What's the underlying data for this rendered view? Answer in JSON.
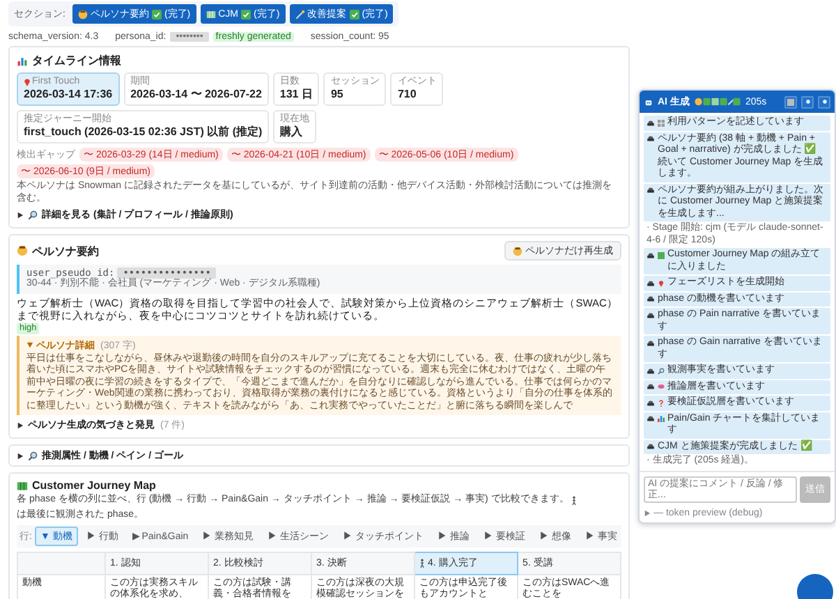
{
  "section_nav": {
    "label": "セクション:",
    "buttons": [
      {
        "label": "ペルソナ要約",
        "status": "(完了)",
        "done": true
      },
      {
        "label": "CJM",
        "status": "(完了)",
        "done": true
      },
      {
        "label": "改善提案",
        "status": "(完了)",
        "done": true
      }
    ]
  },
  "meta": {
    "schema_version": "schema_version: 4.3",
    "persona_id_label": "persona_id:",
    "persona_id": "••••••••",
    "freshness": "freshly generated",
    "session_count": "session_count: 95"
  },
  "timeline": {
    "title": "タイムライン情報",
    "stats": [
      {
        "label": "First Touch",
        "value": "2026-03-14 17:36",
        "selected": true
      },
      {
        "label": "期間",
        "value": "2026-03-14 〜 2026-07-22",
        "selected": false
      },
      {
        "label": "日数",
        "value": "131 日",
        "selected": false
      },
      {
        "label": "セッション",
        "value": "95",
        "selected": false
      },
      {
        "label": "イベント",
        "value": "710",
        "selected": false
      },
      {
        "label": "推定ジャーニー開始",
        "value": "first_touch (2026-03-15 02:36 JST) 以前 (推定)",
        "selected": false
      },
      {
        "label": "現在地",
        "value": "購入",
        "selected": false
      }
    ],
    "gaps_label": "検出ギャップ",
    "gaps": [
      "〜 2026-03-29 (14日 / medium)",
      "〜 2026-04-21 (10日 / medium)",
      "〜 2026-05-06 (10日 / medium)",
      "〜 2026-06-10 (9日 / medium)"
    ],
    "note": "本ペルソナは Snowman に記録されたデータを基にしているが、サイト到達前の活動・他デバイス活動・外部検討活動については推測を含む。",
    "details": "詳細を見る (集計 / プロフィール / 推論原則)"
  },
  "persona": {
    "title": "ペルソナ要約",
    "regen_button": "ペルソナだけ再生成",
    "user_id_label": "user_pseudo_id:",
    "user_id": "•••••••••••••••",
    "profile": "30-44 · 判別不能 · 会社員 (マーケティング · Web · デジタル系職種)",
    "summary": "ウェブ解析士（WAC）資格の取得を目指して学習中の社会人で、試験対策から上位資格のシニアウェブ解析士（SWAC）まで視野に入れながら、夜を中心にコツコツとサイトを訪れ続けている。",
    "confidence": "high",
    "detail_title": "ペルソナ詳細",
    "detail_count": "(307 字)",
    "detail_text": "平日は仕事をこなしながら、昼休みや退勤後の時間を自分のスキルアップに充てることを大切にしている。夜、仕事の疲れが少し落ち着いた頃にスマホやPCを開き、サイトや試験情報をチェックするのが習慣になっている。週末も完全に休むわけではなく、土曜の午前中や日曜の夜に学習の続きをするタイプで、「今週どこまで進んだか」を自分なりに確認しながら進んでいる。仕事では何らかのマーケティング・Web関連の業務に携わっており、資格取得が業務の裏付けになると感じている。資格というより「自分の仕事を体系的に整理したい」という動機が強く、テキストを読みながら「あ、これ実務でやっていたことだ」と腑に落ちる瞬間を楽しんで",
    "insights": "ペルソナ生成の気づきと発見",
    "insights_count": "(7 件)",
    "inferred": "推測属性 / 動機 / ペイン / ゴール"
  },
  "cjm": {
    "title": "Customer Journey Map",
    "desc_before": "各 phase を横の列に並べ、行 (動機 → 行動 → Pain&Gain → タッチポイント → 推論 → 要検証仮説 → 事実) で比較できます。",
    "desc_after": "は最後に観測された phase。",
    "filter_label": "行:",
    "filters": [
      {
        "label": "▼ 動機",
        "selected": true
      },
      {
        "label": "▶ 行動",
        "selected": false
      },
      {
        "label": "▶ Pain&Gain",
        "selected": false
      },
      {
        "label": "▶ 業務知見",
        "selected": false
      },
      {
        "label": "▶ 生活シーン",
        "selected": false
      },
      {
        "label": "▶ タッチポイント",
        "selected": false
      },
      {
        "label": "▶ 推論",
        "selected": false
      },
      {
        "label": "▶ 要検証",
        "selected": false
      },
      {
        "label": "▶ 想像",
        "selected": false
      },
      {
        "label": "▶ 事実",
        "selected": false
      }
    ],
    "phases": [
      {
        "label": "1. 認知",
        "current": false
      },
      {
        "label": "2. 比較検討",
        "current": false
      },
      {
        "label": "3. 決断",
        "current": false
      },
      {
        "label": "4. 購入完了",
        "current": true
      },
      {
        "label": "5. 受講",
        "current": false
      }
    ],
    "rows": [
      {
        "label": "動機",
        "cells": [
          "この方は実務スキルの体系化を求め、",
          "この方は試験・講義・合格者情報を",
          "この方は深夜の大規模確認セッションを",
          "この方は申込完了後もアカウントと",
          "この方はSWACへ進むことを"
        ]
      }
    ]
  },
  "ai_panel": {
    "title": "AI 生成",
    "elapsed": "205s",
    "log": [
      {
        "kind": "step",
        "text": "利用パターンを記述しています"
      },
      {
        "kind": "step",
        "text": "ペルソナ要約 (38 軸 + 動機 + Pain + Goal + narrative) が完成しました ✅ 続いて Customer Journey Map を生成します。"
      },
      {
        "kind": "step",
        "text": "ペルソナ要約が組み上がりました。次に Customer Journey Map と施策提案を生成します..."
      },
      {
        "kind": "note",
        "text": "· Stage 開始: cjm (モデル claude-sonnet-4-6 / 限定 120s)"
      },
      {
        "kind": "step",
        "text": "Customer Journey Map の組み立てに入りました"
      },
      {
        "kind": "step",
        "text": "フェーズリストを生成開始"
      },
      {
        "kind": "step",
        "text": "phase の動機を書いています"
      },
      {
        "kind": "step",
        "text": "phase の Pain narrative を書いています"
      },
      {
        "kind": "step",
        "text": "phase の Gain narrative を書いています"
      },
      {
        "kind": "step",
        "text": "観測事実を書いています"
      },
      {
        "kind": "step",
        "text": "推論層を書いています"
      },
      {
        "kind": "step",
        "text": "要検証仮説層を書いています"
      },
      {
        "kind": "step",
        "text": "Pain/Gain チャートを集計しています"
      },
      {
        "kind": "step",
        "text": "CJM と施策提案が完成しました ✅"
      },
      {
        "kind": "note",
        "text": "· 生成完了 (205s 経過)。"
      }
    ],
    "input_placeholder": "AI の提案にコメント / 反論 / 修正...",
    "send_button": "送信",
    "debug": "— token preview (debug)"
  }
}
